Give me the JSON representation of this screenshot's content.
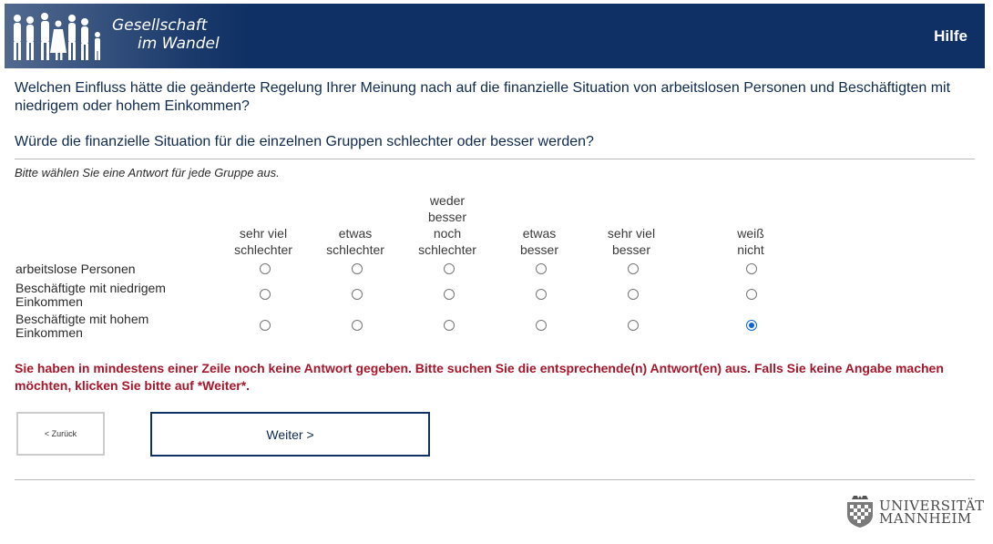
{
  "header": {
    "logo_line1": "Gesellschaft",
    "logo_line2": "im Wandel",
    "help_label": "Hilfe"
  },
  "question": {
    "text": "Welchen Einfluss hätte die geänderte Regelung Ihrer Meinung nach auf die finanzielle Situation von arbeitslosen Personen und Beschäftigten mit niedrigem oder hohem Einkommen?",
    "subtext": "Würde die finanzielle Situation für die einzelnen Gruppen schlechter oder besser werden?",
    "instruction": "Bitte wählen Sie eine Antwort für jede Gruppe aus."
  },
  "grid": {
    "columns": [
      {
        "line1": "sehr viel",
        "line2": "schlechter"
      },
      {
        "line1": "etwas",
        "line2": "schlechter"
      },
      {
        "line1": "weder",
        "line2": "besser",
        "line3": "noch",
        "line4": "schlechter"
      },
      {
        "line1": "etwas",
        "line2": "besser"
      },
      {
        "line1": "sehr viel",
        "line2": "besser"
      },
      {
        "line1": "weiß",
        "line2": "nicht"
      }
    ],
    "rows": [
      {
        "line1": "arbeitslose Personen",
        "selected": null
      },
      {
        "line1": "Beschäftigte mit niedrigem",
        "line2": "Einkommen",
        "selected": null
      },
      {
        "line1": "Beschäftigte mit hohem",
        "line2": "Einkommen",
        "selected": "weiß nicht"
      }
    ]
  },
  "error_message": "Sie haben in mindestens einer Zeile noch keine Antwort gegeben. Bitte suchen Sie die entsprechende(n) Antwort(en) aus. Falls Sie keine Angabe machen möchten, klicken Sie bitte auf *Weiter*.",
  "nav": {
    "back_label": "< Zurück",
    "next_label": "Weiter >"
  },
  "footer": {
    "logo_line1": "UNIVERSITÄT",
    "logo_line2": "MANNHEIM"
  },
  "colors": {
    "header_bg": "#0f3064",
    "error_text": "#a6152a",
    "radio_checked": "#0a66d8"
  }
}
